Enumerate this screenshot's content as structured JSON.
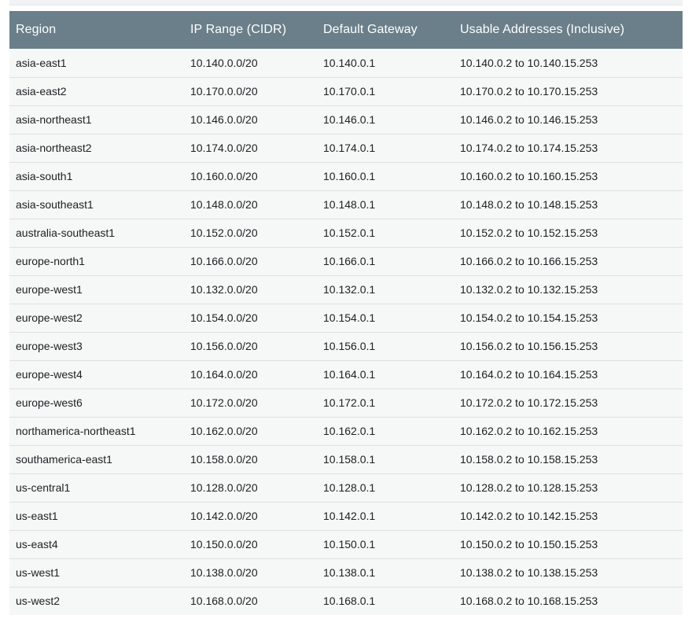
{
  "table": {
    "headers": [
      "Region",
      "IP Range (CIDR)",
      "Default Gateway",
      "Usable Addresses (Inclusive)"
    ],
    "rows": [
      [
        "asia-east1",
        "10.140.0.0/20",
        "10.140.0.1",
        "10.140.0.2 to 10.140.15.253"
      ],
      [
        "asia-east2",
        "10.170.0.0/20",
        "10.170.0.1",
        "10.170.0.2 to 10.170.15.253"
      ],
      [
        "asia-northeast1",
        "10.146.0.0/20",
        "10.146.0.1",
        "10.146.0.2 to 10.146.15.253"
      ],
      [
        "asia-northeast2",
        "10.174.0.0/20",
        "10.174.0.1",
        "10.174.0.2 to 10.174.15.253"
      ],
      [
        "asia-south1",
        "10.160.0.0/20",
        "10.160.0.1",
        "10.160.0.2 to 10.160.15.253"
      ],
      [
        "asia-southeast1",
        "10.148.0.0/20",
        "10.148.0.1",
        "10.148.0.2 to 10.148.15.253"
      ],
      [
        "australia-southeast1",
        "10.152.0.0/20",
        "10.152.0.1",
        "10.152.0.2 to 10.152.15.253"
      ],
      [
        "europe-north1",
        "10.166.0.0/20",
        "10.166.0.1",
        "10.166.0.2 to 10.166.15.253"
      ],
      [
        "europe-west1",
        "10.132.0.0/20",
        "10.132.0.1",
        "10.132.0.2 to 10.132.15.253"
      ],
      [
        "europe-west2",
        "10.154.0.0/20",
        "10.154.0.1",
        "10.154.0.2 to 10.154.15.253"
      ],
      [
        "europe-west3",
        "10.156.0.0/20",
        "10.156.0.1",
        "10.156.0.2 to 10.156.15.253"
      ],
      [
        "europe-west4",
        "10.164.0.0/20",
        "10.164.0.1",
        "10.164.0.2 to 10.164.15.253"
      ],
      [
        "europe-west6",
        "10.172.0.0/20",
        "10.172.0.1",
        "10.172.0.2 to 10.172.15.253"
      ],
      [
        "northamerica-northeast1",
        "10.162.0.0/20",
        "10.162.0.1",
        "10.162.0.2 to 10.162.15.253"
      ],
      [
        "southamerica-east1",
        "10.158.0.0/20",
        "10.158.0.1",
        "10.158.0.2 to 10.158.15.253"
      ],
      [
        "us-central1",
        "10.128.0.0/20",
        "10.128.0.1",
        "10.128.0.2 to 10.128.15.253"
      ],
      [
        "us-east1",
        "10.142.0.0/20",
        "10.142.0.1",
        "10.142.0.2 to 10.142.15.253"
      ],
      [
        "us-east4",
        "10.150.0.0/20",
        "10.150.0.1",
        "10.150.0.2 to 10.150.15.253"
      ],
      [
        "us-west1",
        "10.138.0.0/20",
        "10.138.0.1",
        "10.138.0.2 to 10.138.15.253"
      ],
      [
        "us-west2",
        "10.168.0.0/20",
        "10.168.0.1",
        "10.168.0.2 to 10.168.15.253"
      ]
    ]
  },
  "colors": {
    "header_bg": "#6b7f8a",
    "header_text": "#ffffff",
    "row_bg": "#f6f7f7",
    "row_border": "#e0e0e0"
  }
}
